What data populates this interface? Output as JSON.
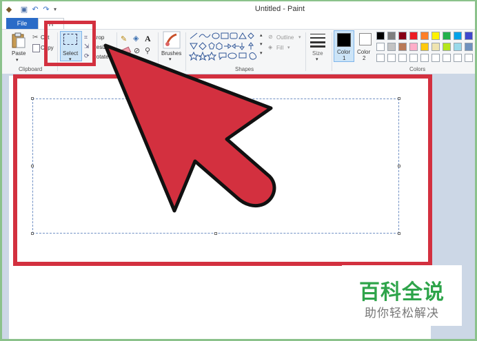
{
  "window": {
    "title": "Untitled - Paint"
  },
  "tabs": {
    "file": "File",
    "home": "H"
  },
  "ribbon": {
    "clipboard": {
      "paste": "Paste",
      "cut": "Cut",
      "copy": "Copy",
      "group_label": "Clipboard"
    },
    "image": {
      "select": "Select",
      "crop": "Crop",
      "resize": "Resize",
      "rotate": "Rotate"
    },
    "brushes": "Brushes",
    "shapes": {
      "outline": "Outline",
      "fill": "Fill",
      "group_label": "Shapes"
    },
    "size": "Size",
    "color1_label": "Color",
    "color1_num": "1",
    "color2_label": "Color",
    "color2_num": "2",
    "colors_group_label": "Colors",
    "palette_row1": [
      "#000000",
      "#7f7f7f",
      "#880015",
      "#ed1c24",
      "#ff7f27",
      "#fff200",
      "#22b14c",
      "#00a2e8",
      "#3f48cc"
    ],
    "palette_row2": [
      "#ffffff",
      "#c3c3c3",
      "#b97a57",
      "#ffaec9",
      "#ffc90e",
      "#efe4b0",
      "#b5e61d",
      "#99d9ea",
      "#7092be"
    ]
  },
  "annotation": {
    "highlight_color": "#d3303f"
  },
  "watermark": {
    "main": "百科全说",
    "sub": "助你轻松解决"
  }
}
